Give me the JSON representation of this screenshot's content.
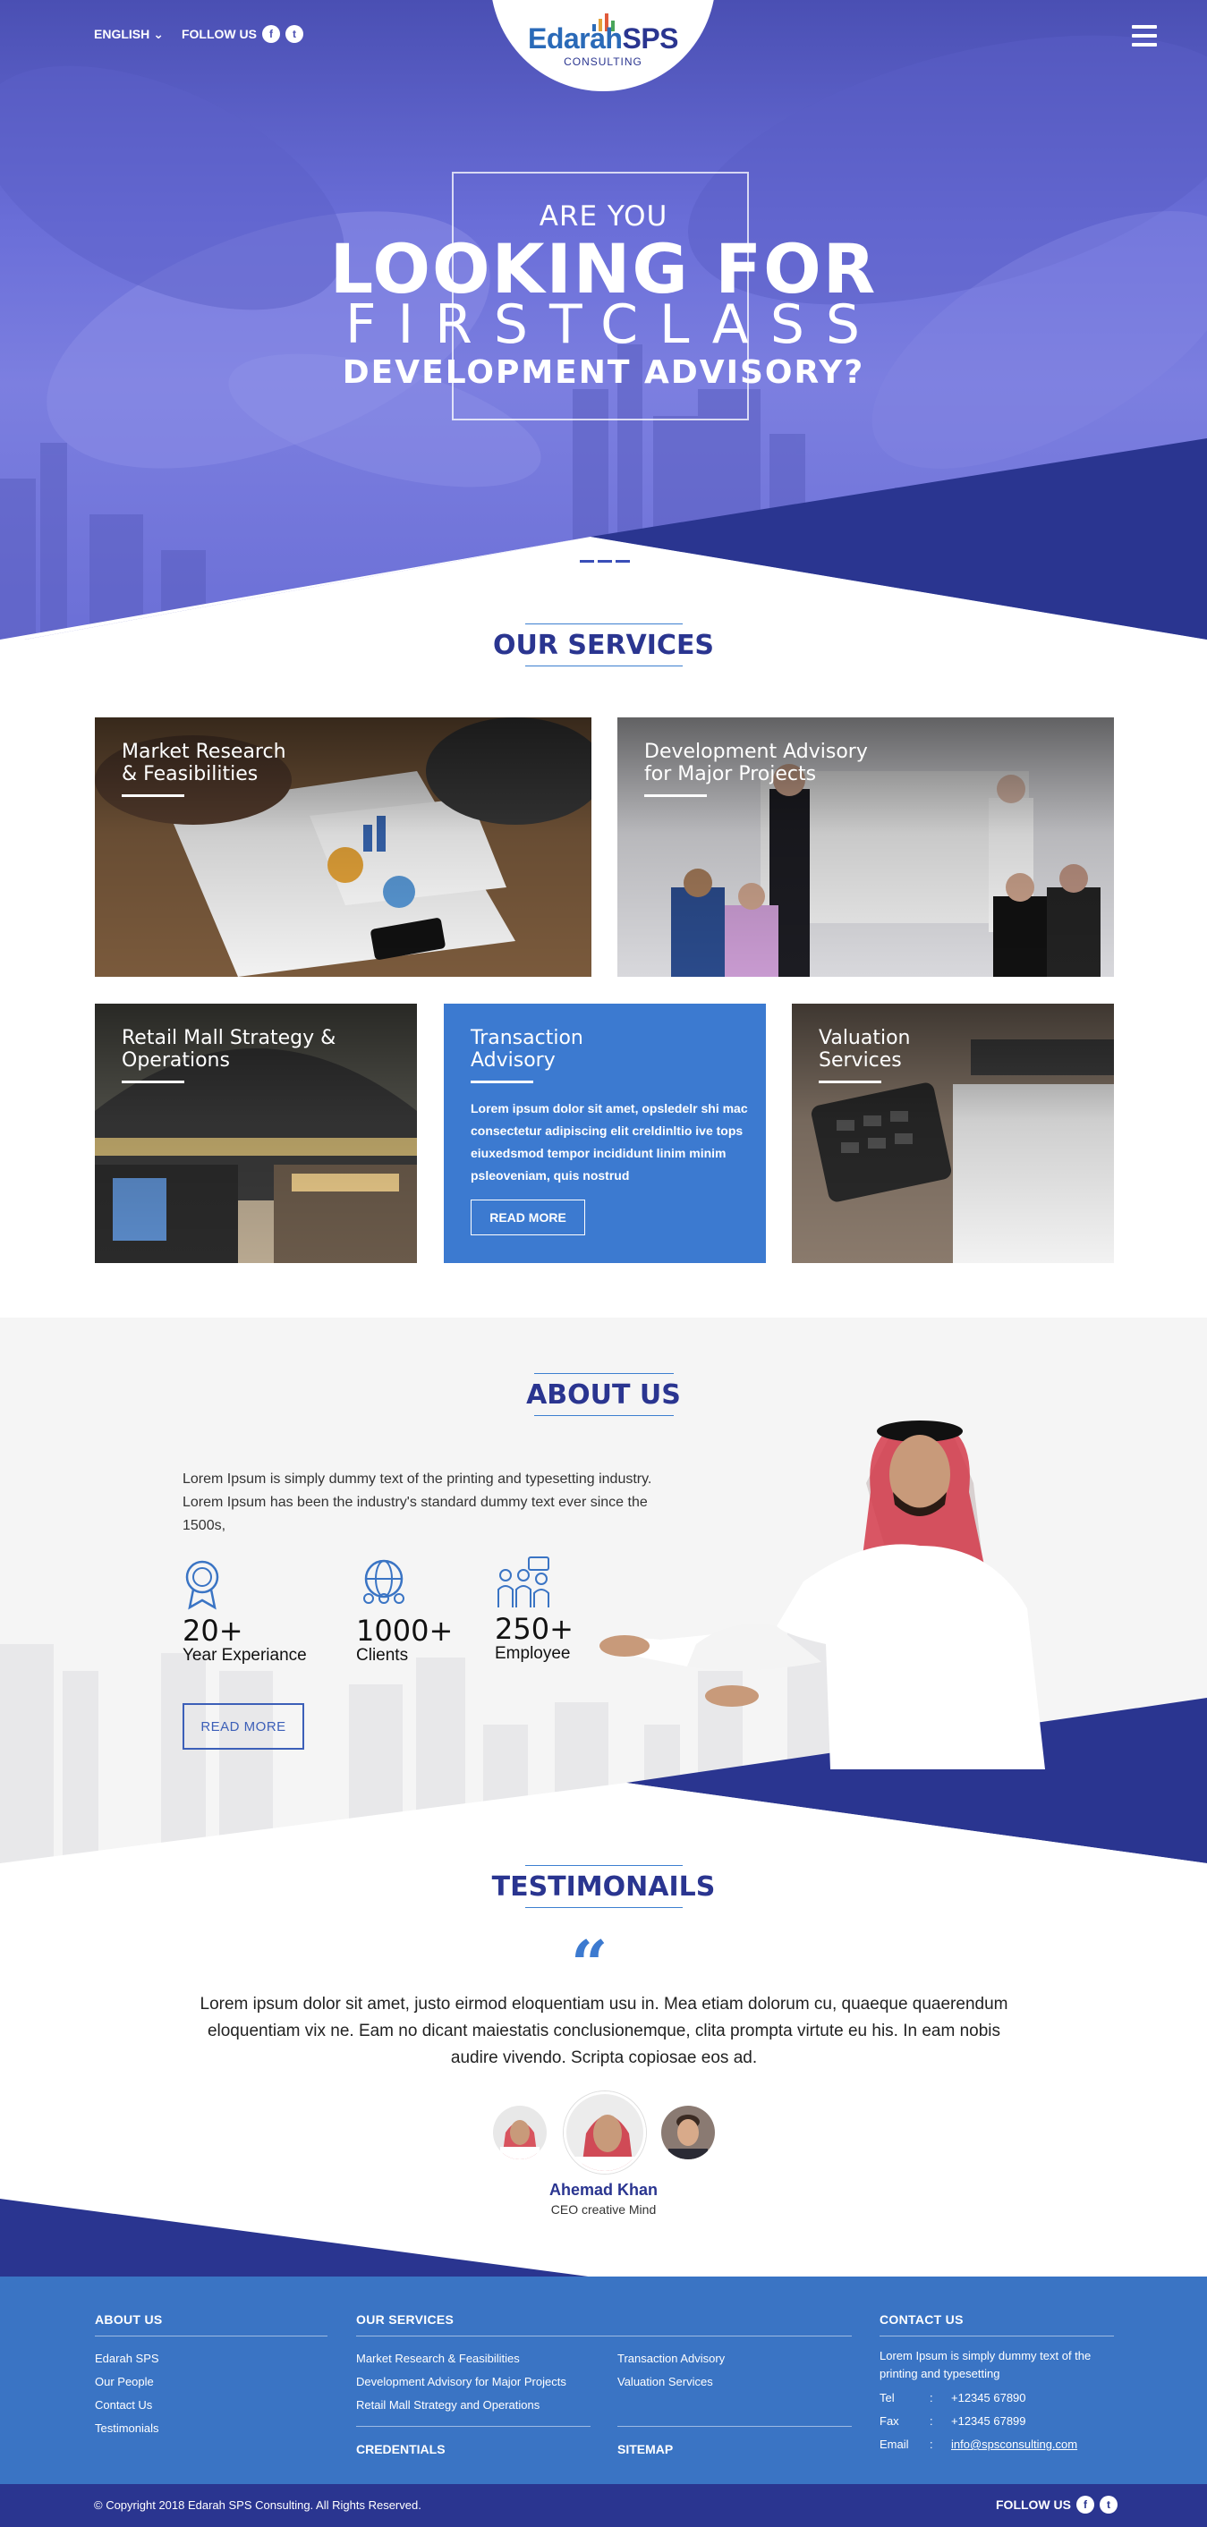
{
  "header": {
    "language": "ENGLISH",
    "follow_label": "FOLLOW US",
    "social_icons": [
      "facebook-icon",
      "twitter-icon"
    ],
    "logo_main": "Edarah",
    "logo_accent": "SPS",
    "logo_sub": "CONSULTING",
    "menu_icon": "hamburger-icon"
  },
  "hero": {
    "line1": "ARE YOU",
    "line2": "LOOKING FOR",
    "line3": "FIRSTCLASS",
    "line4": "DEVELOPMENT ADVISORY?"
  },
  "services": {
    "title": "OUR SERVICES",
    "cards": [
      {
        "title": "Market Research\n& Feasibilities"
      },
      {
        "title": "Development Advisory\nfor Major Projects"
      },
      {
        "title": "Retail Mall Strategy &\nOperations"
      },
      {
        "title": "Transaction\nAdvisory",
        "desc": "Lorem ipsum dolor sit amet, opsledelr shi mac consectetur adipiscing elit creldinltio ive tops eiuxedsmod tempor incididunt linim minim psleoveniam, quis nostrud",
        "button": "READ MORE"
      },
      {
        "title": "Valuation\nServices"
      }
    ]
  },
  "about": {
    "title": "ABOUT US",
    "text": "Lorem Ipsum is simply dummy text of the printing and typesetting industry. Lorem Ipsum has been the industry's standard dummy text ever since the 1500s,",
    "stats": [
      {
        "value": "20+",
        "label": "Year Experiance",
        "icon": "award-icon"
      },
      {
        "value": "1000+",
        "label": "Clients",
        "icon": "globe-people-icon"
      },
      {
        "value": "250+",
        "label": "Employee",
        "icon": "team-icon"
      }
    ],
    "button": "READ MORE"
  },
  "testimonials": {
    "title": "TESTIMONAILS",
    "quote": "Lorem ipsum dolor sit amet, justo eirmod eloquentiam usu in. Mea etiam dolorum cu, quaeque quaerendum eloquentiam vix ne. Eam no dicant maiestatis conclusionemque, clita prompta virtute eu his. In eam nobis audire vivendo. Scripta copiosae eos ad.",
    "name": "Ahemad Khan",
    "role": "CEO creative Mind"
  },
  "footer": {
    "about_heading": "ABOUT US",
    "about_links": [
      "Edarah SPS",
      "Our People",
      "Contact Us",
      "Testimonials"
    ],
    "services_heading": "OUR SERVICES",
    "services_links_left": [
      "Market Research & Feasibilities",
      "Development Advisory for Major Projects",
      "Retail Mall Strategy and Operations"
    ],
    "services_links_right": [
      "Transaction Advisory",
      "Valuation Services"
    ],
    "credentials": "CREDENTIALS",
    "sitemap": "SITEMAP",
    "contact_heading": "CONTACT US",
    "contact_text": "Lorem Ipsum is simply dummy text of the printing and typesetting",
    "tel_label": "Tel",
    "tel": "+12345 67890",
    "fax_label": "Fax",
    "fax": "+12345 67899",
    "email_label": "Email",
    "email": "info@spsconsulting.com",
    "separator": ":"
  },
  "bottom": {
    "copyright": "© Copyright 2018  Edarah SPS Consulting. All Rights Reserved.",
    "follow_label": "FOLLOW US"
  },
  "colors": {
    "navy": "#2a3590",
    "blue": "#3a74c4",
    "hero_purple": "#6a6ed8"
  }
}
